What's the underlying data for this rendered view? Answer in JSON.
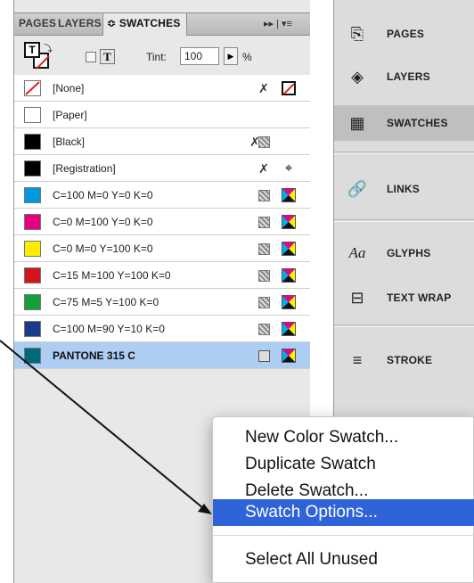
{
  "panel": {
    "tabs": [
      "PAGES",
      "LAYERS",
      "SWATCHES"
    ],
    "tab_separator": "≎",
    "menu_glyphs": "▸▸ | ▾≡",
    "tint_label": "Tint:",
    "tint_value": "100",
    "tint_unit": "%",
    "fill_glyph": "T",
    "text_glyph": "T",
    "swatches": [
      {
        "name": "[None]",
        "color": "#ffffff"
      },
      {
        "name": "[Paper]",
        "color": "#ffffff"
      },
      {
        "name": "[Black]",
        "color": "#000000"
      },
      {
        "name": "[Registration]",
        "color": "#000000"
      },
      {
        "name": "C=100 M=0 Y=0 K=0",
        "color": "#0098df"
      },
      {
        "name": "C=0 M=100 Y=0 K=0",
        "color": "#e5007e"
      },
      {
        "name": "C=0 M=0 Y=100 K=0",
        "color": "#ffec00"
      },
      {
        "name": "C=15 M=100 Y=100 K=0",
        "color": "#d2141d"
      },
      {
        "name": "C=75 M=5 Y=100 K=0",
        "color": "#16a03a"
      },
      {
        "name": "C=100 M=90 Y=10 K=0",
        "color": "#1b3a8c"
      },
      {
        "name": "PANTONE 315 C",
        "color": "#006a7a"
      }
    ]
  },
  "dock": {
    "items": [
      "PAGES",
      "LAYERS",
      "SWATCHES",
      "LINKS",
      "GLYPHS",
      "TEXT WRAP",
      "STROKE"
    ],
    "glyphs_icon_text": "Aa"
  },
  "context_menu": {
    "items": [
      "New Color Swatch...",
      "Duplicate Swatch",
      "Delete Swatch...",
      "Swatch Options...",
      "Select All Unused"
    ]
  },
  "colors": {
    "menu_highlight": "#2f63d8",
    "selected_row": "#aecdf2"
  }
}
